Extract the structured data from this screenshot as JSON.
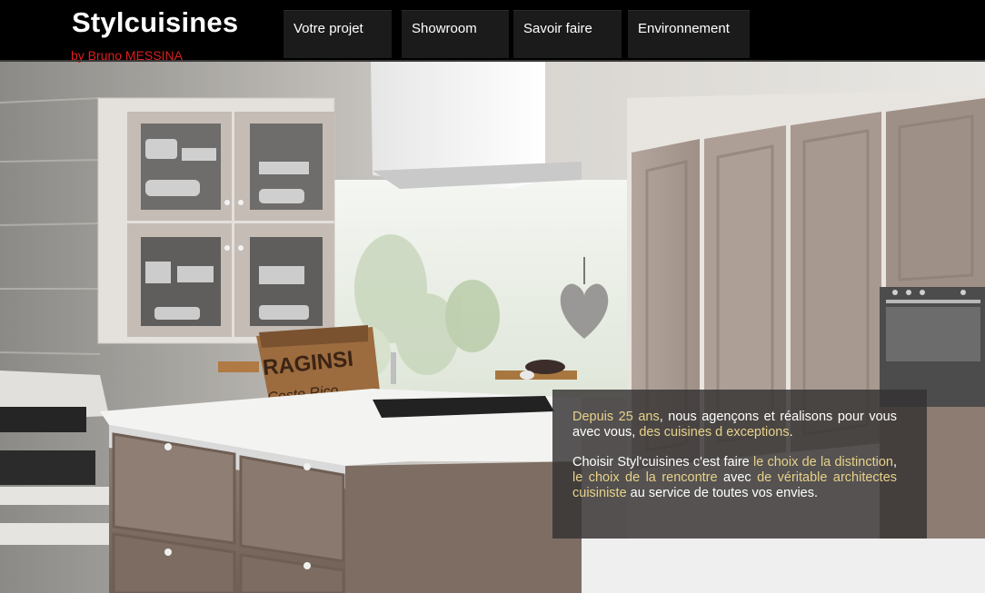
{
  "brand": {
    "title": "Stylcuisines",
    "subtitle": "by Bruno MESSINA"
  },
  "nav": {
    "items": [
      {
        "label": "Votre projet"
      },
      {
        "label": "Showroom"
      },
      {
        "label": "Savoir faire"
      },
      {
        "label": "Environnement"
      }
    ]
  },
  "info": {
    "p1": {
      "hl1": "Depuis 25 ans",
      "t1": ", nous agençons et réalisons pour vous avec vous, ",
      "hl2": "des cuisines d exceptions",
      "t2": "."
    },
    "p2": {
      "t1": "Choisir Styl'cuisines c'est faire ",
      "hl1": "le choix de la distinction",
      "t2": ", ",
      "hl2": "le choix de la rencontre",
      "t3": " avec ",
      "hl3": "de véritable architectes cuisiniste",
      "t4": " au service de toutes vos envies."
    }
  },
  "hero": {
    "bag_text_1": "RAGINSI",
    "bag_text_2": "Coste Rico"
  },
  "colors": {
    "accent_text": "#e8d28a",
    "subtitle": "#e01e1e",
    "header_bg": "#000000",
    "nav_bg": "#1b1b1b"
  }
}
